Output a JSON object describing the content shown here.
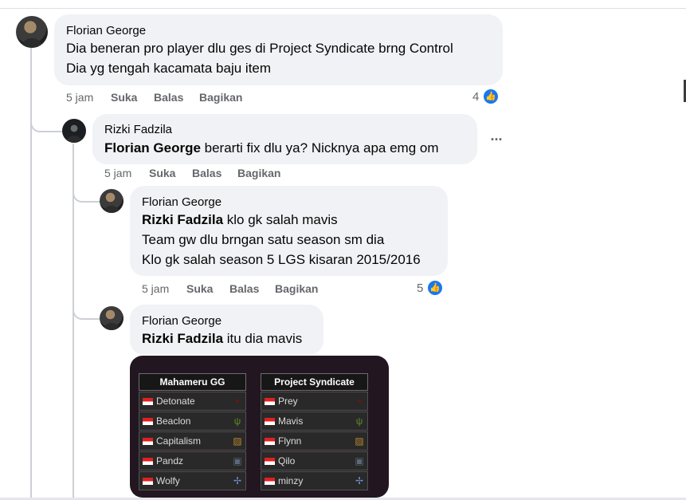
{
  "comments": [
    {
      "author": "Florian George",
      "lines": [
        {
          "text": "Dia beneran pro player dlu ges di Project Syndicate brng Control"
        },
        {
          "text": "Dia yg tengah kacamata baju item"
        }
      ],
      "time": "5 jam",
      "actions": {
        "like": "Suka",
        "reply": "Balas",
        "share": "Bagikan"
      },
      "reactions": "4"
    },
    {
      "author": "Rizki Fadzila",
      "lines": [
        {
          "mention": "Florian George",
          "text": " berarti fix dlu ya? Nicknya apa emg om"
        }
      ],
      "time": "5 jam",
      "actions": {
        "like": "Suka",
        "reply": "Balas",
        "share": "Bagikan"
      },
      "more": "..."
    },
    {
      "author": "Florian George",
      "lines": [
        {
          "mention": "Rizki Fadzila",
          "text": " klo gk salah mavis"
        },
        {
          "text": "Team gw dlu brngan satu season sm dia"
        },
        {
          "text": "Klo gk salah season 5 LGS kisaran 2015/2016"
        }
      ],
      "time": "5 jam",
      "actions": {
        "like": "Suka",
        "reply": "Balas",
        "share": "Bagikan"
      },
      "reactions": "5"
    },
    {
      "author": "Florian George",
      "lines": [
        {
          "mention": "Rizki Fadzila",
          "text": " itu dia mavis"
        }
      ]
    }
  ],
  "image": {
    "teams": [
      {
        "name": "Mahameru GG",
        "players": [
          "Detonate",
          "Beaclon",
          "Capitalism",
          "Pandz",
          "Wolfy"
        ]
      },
      {
        "name": "Project Syndicate",
        "players": [
          "Prey",
          "Mavis",
          "Flynn",
          "Qilo",
          "minzy"
        ]
      }
    ],
    "role_icons": [
      "jungle-icon",
      "leaf-icon",
      "sword-icon",
      "shield-icon",
      "support-icon"
    ]
  },
  "colors": {
    "bubble": "#f0f2f5",
    "like": "#1877f2",
    "muted": "#65676b"
  }
}
